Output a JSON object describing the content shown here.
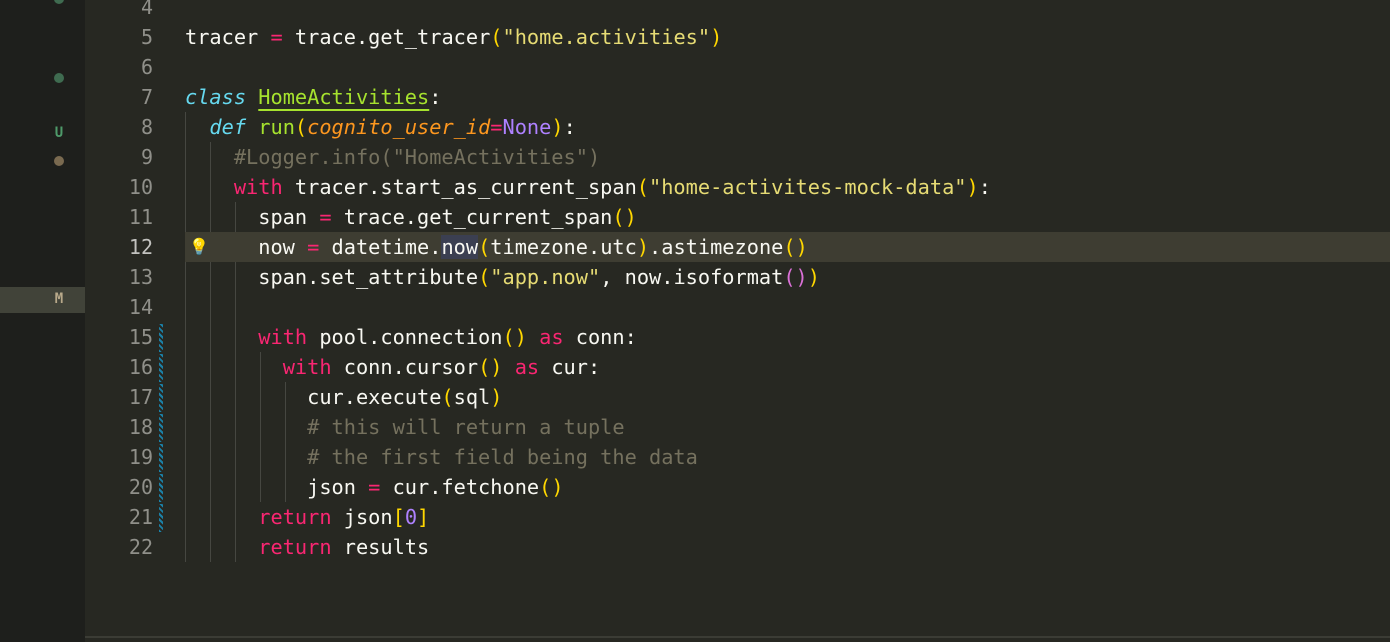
{
  "scm": {
    "untracked_label": "U",
    "modified_label": "M"
  },
  "editor": {
    "current_line": 12,
    "lines": [
      {
        "n": "4",
        "tokens": []
      },
      {
        "n": "5",
        "tokens": [
          {
            "t": "tracer ",
            "c": "w"
          },
          {
            "t": "=",
            "c": "k"
          },
          {
            "t": " trace.get_tracer",
            "c": "w"
          },
          {
            "t": "(",
            "c": "b1"
          },
          {
            "t": "\"home.activities\"",
            "c": "s"
          },
          {
            "t": ")",
            "c": "b1"
          }
        ]
      },
      {
        "n": "6",
        "tokens": []
      },
      {
        "n": "7",
        "tokens": [
          {
            "t": "class",
            "c": "c"
          },
          {
            "t": " ",
            "c": "w"
          },
          {
            "t": "HomeActivities",
            "c": "cls"
          },
          {
            "t": ":",
            "c": "w"
          }
        ]
      },
      {
        "n": "8",
        "tokens": [
          {
            "t": "  ",
            "c": "w"
          },
          {
            "t": "def",
            "c": "c"
          },
          {
            "t": " ",
            "c": "w"
          },
          {
            "t": "run",
            "c": "f"
          },
          {
            "t": "(",
            "c": "b1"
          },
          {
            "t": "cognito_user_id",
            "c": "p"
          },
          {
            "t": "=",
            "c": "k"
          },
          {
            "t": "None",
            "c": "n"
          },
          {
            "t": ")",
            "c": "b1"
          },
          {
            "t": ":",
            "c": "w"
          }
        ]
      },
      {
        "n": "9",
        "tokens": [
          {
            "t": "    #Logger.info(\"HomeActivities\")",
            "c": "cm"
          }
        ]
      },
      {
        "n": "10",
        "tokens": [
          {
            "t": "    ",
            "c": "w"
          },
          {
            "t": "with",
            "c": "k"
          },
          {
            "t": " tracer.start_as_current_span",
            "c": "w"
          },
          {
            "t": "(",
            "c": "b1"
          },
          {
            "t": "\"home-activites-mock-data\"",
            "c": "s"
          },
          {
            "t": ")",
            "c": "b1"
          },
          {
            "t": ":",
            "c": "w"
          }
        ]
      },
      {
        "n": "11",
        "tokens": [
          {
            "t": "      span ",
            "c": "w"
          },
          {
            "t": "=",
            "c": "k"
          },
          {
            "t": " trace.get_current_span",
            "c": "w"
          },
          {
            "t": "()",
            "c": "b1"
          }
        ]
      },
      {
        "n": "12",
        "tokens": [
          {
            "t": "      now ",
            "c": "w"
          },
          {
            "t": "=",
            "c": "k"
          },
          {
            "t": " datetime.",
            "c": "w"
          },
          {
            "t": "now",
            "c": "w hl"
          },
          {
            "t": "(",
            "c": "b1"
          },
          {
            "t": "timezone.utc",
            "c": "w"
          },
          {
            "t": ")",
            "c": "b1"
          },
          {
            "t": ".astimezone",
            "c": "w"
          },
          {
            "t": "()",
            "c": "b1"
          }
        ]
      },
      {
        "n": "13",
        "tokens": [
          {
            "t": "      span.set_attribute",
            "c": "w"
          },
          {
            "t": "(",
            "c": "b1"
          },
          {
            "t": "\"app.now\"",
            "c": "s"
          },
          {
            "t": ", now.isoformat",
            "c": "w"
          },
          {
            "t": "()",
            "c": "b2"
          },
          {
            "t": ")",
            "c": "b1"
          }
        ]
      },
      {
        "n": "14",
        "tokens": []
      },
      {
        "n": "15",
        "tokens": [
          {
            "t": "      ",
            "c": "w"
          },
          {
            "t": "with",
            "c": "k"
          },
          {
            "t": " pool.connection",
            "c": "w"
          },
          {
            "t": "()",
            "c": "b1"
          },
          {
            "t": " ",
            "c": "w"
          },
          {
            "t": "as",
            "c": "k"
          },
          {
            "t": " conn:",
            "c": "w"
          }
        ]
      },
      {
        "n": "16",
        "tokens": [
          {
            "t": "        ",
            "c": "w"
          },
          {
            "t": "with",
            "c": "k"
          },
          {
            "t": " conn.cursor",
            "c": "w"
          },
          {
            "t": "()",
            "c": "b1"
          },
          {
            "t": " ",
            "c": "w"
          },
          {
            "t": "as",
            "c": "k"
          },
          {
            "t": " cur:",
            "c": "w"
          }
        ]
      },
      {
        "n": "17",
        "tokens": [
          {
            "t": "          cur.execute",
            "c": "w"
          },
          {
            "t": "(",
            "c": "b1"
          },
          {
            "t": "sql",
            "c": "w"
          },
          {
            "t": ")",
            "c": "b1"
          }
        ]
      },
      {
        "n": "18",
        "tokens": [
          {
            "t": "          # this will return a tuple",
            "c": "cm"
          }
        ]
      },
      {
        "n": "19",
        "tokens": [
          {
            "t": "          # the first field being the data",
            "c": "cm"
          }
        ]
      },
      {
        "n": "20",
        "tokens": [
          {
            "t": "          json ",
            "c": "w"
          },
          {
            "t": "=",
            "c": "k"
          },
          {
            "t": " cur.fetchone",
            "c": "w"
          },
          {
            "t": "()",
            "c": "b1"
          }
        ]
      },
      {
        "n": "21",
        "tokens": [
          {
            "t": "      ",
            "c": "w"
          },
          {
            "t": "return",
            "c": "k"
          },
          {
            "t": " json",
            "c": "w"
          },
          {
            "t": "[",
            "c": "b1"
          },
          {
            "t": "0",
            "c": "n"
          },
          {
            "t": "]",
            "c": "b1"
          }
        ]
      },
      {
        "n": "22",
        "tokens": [
          {
            "t": "      ",
            "c": "w"
          },
          {
            "t": "return",
            "c": "k"
          },
          {
            "t": " results",
            "c": "w"
          }
        ]
      }
    ]
  }
}
